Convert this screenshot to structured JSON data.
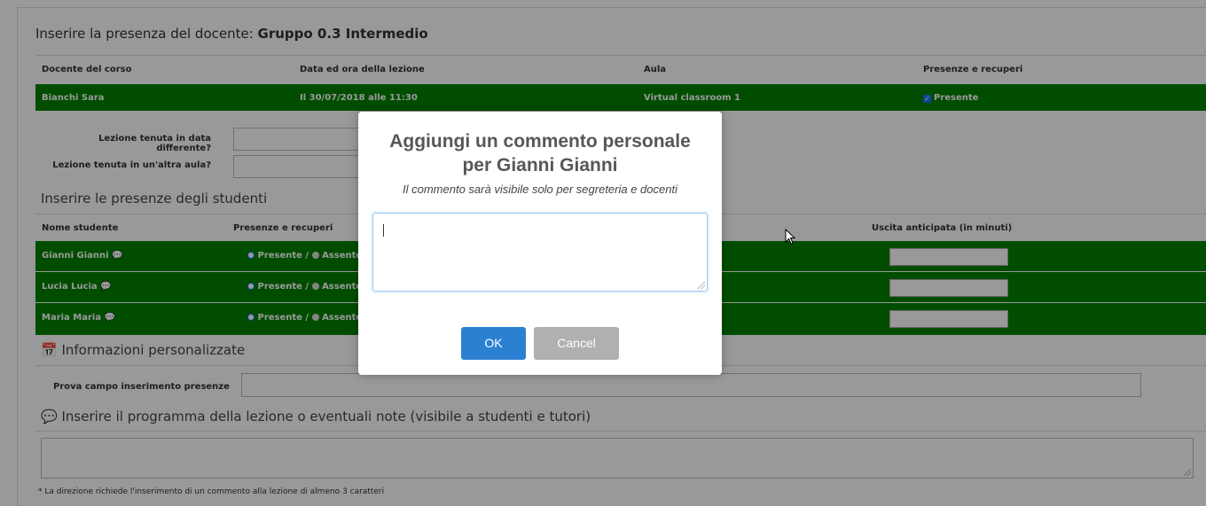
{
  "header": {
    "title_prefix": "Inserire la presenza del docente: ",
    "title_group": "Gruppo 0.3 Intermedio"
  },
  "teacher_table": {
    "columns": [
      "Docente del corso",
      "Data ed ora della lezione",
      "Aula",
      "Presenze e recuperi"
    ],
    "row": {
      "teacher": "Bianchi Sara",
      "datetime": "Il 30/07/2018 alle 11:30",
      "room": "Virtual classroom 1",
      "attendance_label": "Presente",
      "attendance_checked": true
    }
  },
  "form": {
    "different_date_label": "Lezione tenuta in data differente?",
    "different_room_label": "Lezione tenuta in un'altra aula?"
  },
  "students": {
    "section_title": "Inserire le presenze degli studenti",
    "columns": [
      "Nome studente",
      "Presenze e recuperi",
      "Uscita anticipata (in minuti)"
    ],
    "rows": [
      {
        "name": "Gianni Gianni",
        "present_label": "Presente",
        "separator": " / ",
        "absent_label": "Assente"
      },
      {
        "name": "Lucia Lucia",
        "present_label": "Presente",
        "separator": " / ",
        "absent_label": "Assente"
      },
      {
        "name": "Maria Maria",
        "present_label": "Presente",
        "separator": " / ",
        "absent_label": "Assente"
      }
    ]
  },
  "custom_info": {
    "section_title": "Informazioni personalizzate",
    "field_label": "Prova campo inserimento presenze"
  },
  "program": {
    "section_title": "Inserire il programma della lezione o eventuali note (visibile a studenti e tutori)",
    "footnote": "* La direzione richiede l'inserimento di un commento alla lezione di almeno 3 caratteri"
  },
  "modal": {
    "title_line1": "Aggiungi un commento personale",
    "title_line2": "per Gianni Gianni",
    "subtitle": "Il commento sarà visibile solo per segreteria e docenti",
    "ok_label": "OK",
    "cancel_label": "Cancel"
  },
  "colors": {
    "row_green": "#008000",
    "ok_blue": "#2b80d2",
    "cancel_gray": "#b0b0b0"
  }
}
